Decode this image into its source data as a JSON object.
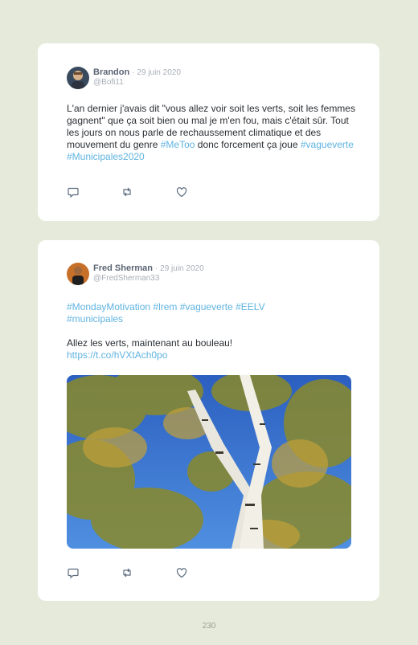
{
  "tweets": [
    {
      "name": "Brandon",
      "date": "· 29 juin 2020",
      "handle": "@Bofi11",
      "text_parts": [
        {
          "t": "L'an dernier j'avais dit \"vous allez voir soit les verts, soit les femmes gagnent\" que ça soit bien ou mal je m'en fou, mais c'était sûr. Tout les jours on nous parle de rechaussement climatique et des mouvement du genre "
        },
        {
          "t": "#MeToo",
          "tag": true
        },
        {
          "t": " donc forcement ça joue "
        },
        {
          "t": "#vagueverte",
          "tag": true
        },
        {
          "t": " "
        },
        {
          "t": "#Municipales2020",
          "tag": true
        }
      ]
    },
    {
      "name": "Fred Sherman",
      "date": "· 29 juin 2020",
      "handle": "@FredSherman33",
      "hashtags": "#MondayMotivation #lrem #vagueverte #EELV #municipales",
      "text": "Allez les verts, maintenant au bouleau!",
      "link": "https://t.co/hVXtAch0po"
    }
  ],
  "icons": [
    "reply-icon",
    "retweet-icon",
    "like-icon"
  ],
  "colors": {
    "background": "#e6eadb",
    "card": "#ffffff",
    "link": "#5fb3e0"
  },
  "page_number": "230"
}
